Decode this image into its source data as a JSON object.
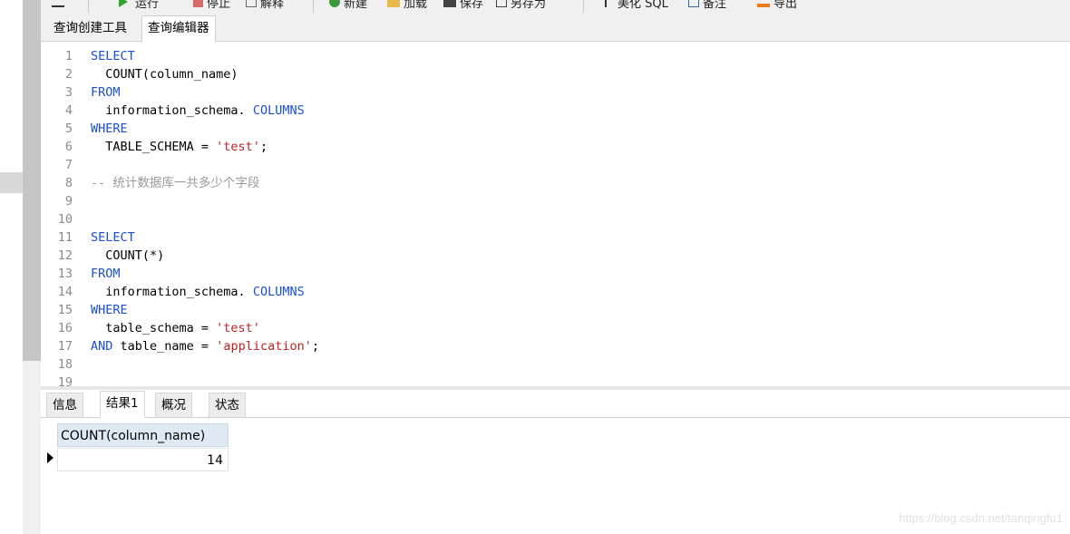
{
  "toolbar": {
    "run_label": "运行",
    "stop_label": "停止",
    "explain_label": "解释",
    "new_label": "新建",
    "load_label": "加载",
    "save_label": "保存",
    "saveas_label": "另存为",
    "beautify_label": "美化 SQL",
    "comment_label": "备注",
    "export_label": "导出"
  },
  "editor_tabs": [
    {
      "label": "查询创建工具"
    },
    {
      "label": "查询编辑器"
    }
  ],
  "code_lines": [
    {
      "num": "1",
      "a": "",
      "kw": "SELECT",
      "b": "",
      "str": "",
      "c": ""
    },
    {
      "num": "2",
      "a": "  COUNT(column_name)",
      "kw": "",
      "b": "",
      "str": "",
      "c": ""
    },
    {
      "num": "3",
      "a": "",
      "kw": "FROM",
      "b": "",
      "str": "",
      "c": ""
    },
    {
      "num": "4",
      "a": "  information_schema.",
      "kw": " COLUMNS",
      "b": "",
      "str": "",
      "c": ""
    },
    {
      "num": "5",
      "a": "",
      "kw": "WHERE",
      "b": "",
      "str": "",
      "c": ""
    },
    {
      "num": "6",
      "a": "  TABLE_SCHEMA = ",
      "kw": "",
      "b": "",
      "str": "'test'",
      "c": ";"
    },
    {
      "num": "7",
      "a": "",
      "kw": "",
      "b": "",
      "str": "",
      "c": ""
    },
    {
      "num": "8",
      "cmt": "-- 统计数据库一共多少个字段"
    },
    {
      "num": "9",
      "a": "",
      "kw": "",
      "b": "",
      "str": "",
      "c": ""
    },
    {
      "num": "10",
      "a": "",
      "kw": "",
      "b": "",
      "str": "",
      "c": ""
    },
    {
      "num": "11",
      "a": "",
      "kw": "SELECT",
      "b": "",
      "str": "",
      "c": ""
    },
    {
      "num": "12",
      "a": "  COUNT(*)",
      "kw": "",
      "b": "",
      "str": "",
      "c": ""
    },
    {
      "num": "13",
      "a": "",
      "kw": "FROM",
      "b": "",
      "str": "",
      "c": ""
    },
    {
      "num": "14",
      "a": "  information_schema.",
      "kw": " COLUMNS",
      "b": "",
      "str": "",
      "c": ""
    },
    {
      "num": "15",
      "a": "",
      "kw": "WHERE",
      "b": "",
      "str": "",
      "c": ""
    },
    {
      "num": "16",
      "a": "  table_schema = ",
      "kw": "",
      "b": "",
      "str": "'test'",
      "c": ""
    },
    {
      "num": "17",
      "a": "",
      "kw": "AND",
      "b": " table_name = ",
      "str": "'application'",
      "c": ";"
    },
    {
      "num": "18",
      "a": "",
      "kw": "",
      "b": "",
      "str": "",
      "c": ""
    },
    {
      "num": "19",
      "a": "",
      "kw": "",
      "b": "",
      "str": "",
      "c": ""
    }
  ],
  "result_tabs": [
    {
      "label": "信息"
    },
    {
      "label": "结果1"
    },
    {
      "label": "概况"
    },
    {
      "label": "状态"
    }
  ],
  "result_grid": {
    "columns": [
      "COUNT(column_name)"
    ],
    "rows": [
      [
        "14"
      ]
    ]
  },
  "watermark": "https://blog.csdn.net/tanqingfu1",
  "colors": {
    "keyword": "#1a4fd6",
    "string": "#c02020",
    "comment": "#9a9a9a",
    "header_bg": "#dfe9f4"
  }
}
